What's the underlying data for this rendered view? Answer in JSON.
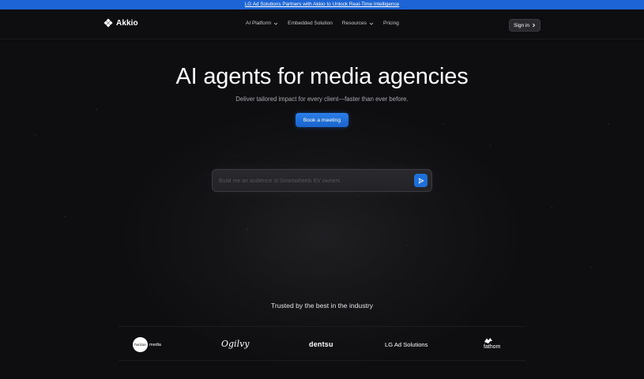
{
  "announcement": {
    "text": "LG Ad Solutions Partners with Akkio to Unlock Real-Time Intelligence"
  },
  "nav": {
    "logo": "Akkio",
    "items": [
      {
        "label": "AI Platform",
        "has_dropdown": true
      },
      {
        "label": "Embedded Solution",
        "has_dropdown": false
      },
      {
        "label": "Resources",
        "has_dropdown": true
      },
      {
        "label": "Pricing",
        "has_dropdown": false
      }
    ],
    "signin": "Sign in"
  },
  "hero": {
    "title": "AI agents for media agencies",
    "subtitle": "Deliver tailored impact for every client—faster than ever before.",
    "cta": "Book a meeting"
  },
  "prompt": {
    "placeholder": "Build me an audience of Smartwheels EV owners"
  },
  "trusted": {
    "heading": "Trusted by the best in the industry",
    "logos": {
      "horizon_circle": "horizon",
      "horizon_word": "media",
      "ogilvy": "Ogilvy",
      "dentsu": "dentsu",
      "lg": "LG Ad Solutions",
      "fathom": "fathom"
    }
  },
  "colors": {
    "accent": "#1d64d6",
    "background": "#0e0e10",
    "button": "#1f6fd9"
  }
}
